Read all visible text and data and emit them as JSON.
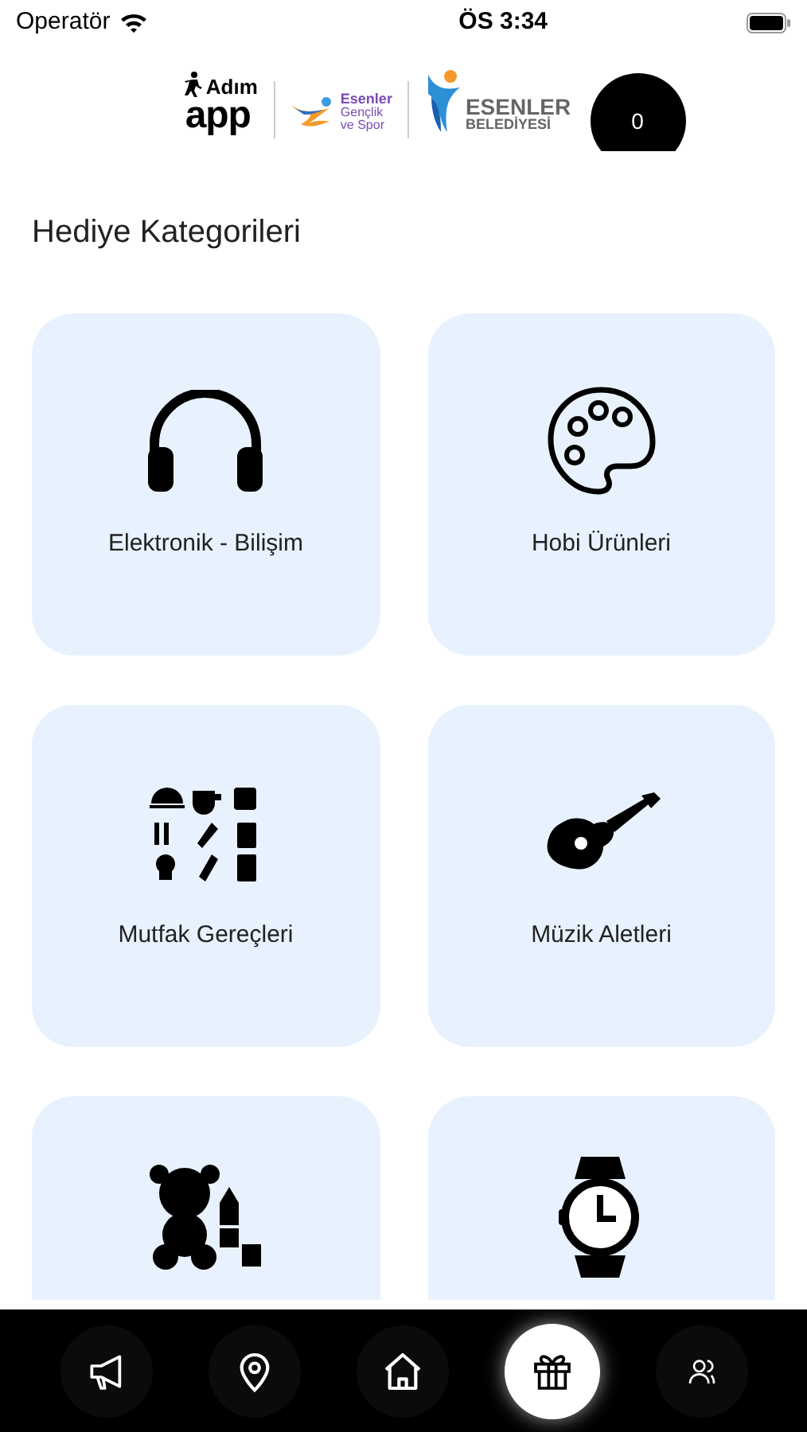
{
  "status_bar": {
    "carrier": "Operatör",
    "time": "ÖS 3:34"
  },
  "header": {
    "logos": [
      {
        "kind": "adim",
        "line_1": "Adım",
        "line_2": "app"
      },
      {
        "kind": "genclik",
        "line_1": "Esenler",
        "line_2": "Gençlik",
        "line_3": "ve Spor"
      },
      {
        "kind": "belediye",
        "line_1": "ESENLER",
        "line_2": "BELEDİYESİ"
      }
    ],
    "points_badge": "0"
  },
  "title": "Hediye Kategorileri",
  "categories": [
    {
      "label": "Elektronik - Bilişim",
      "cut_off": false
    },
    {
      "label": "Hobi Ürünleri",
      "cut_off": false
    },
    {
      "label": "Mutfak Gereçleri",
      "cut_off": false
    },
    {
      "label": "Müzik Aletleri",
      "cut_off": false
    },
    {
      "cut_off": true
    },
    {
      "cut_off": true
    }
  ],
  "bottom_nav": [
    {
      "selected": false
    },
    {
      "selected": false
    },
    {
      "selected": false
    },
    {
      "selected": true
    },
    {
      "selected": false
    }
  ]
}
